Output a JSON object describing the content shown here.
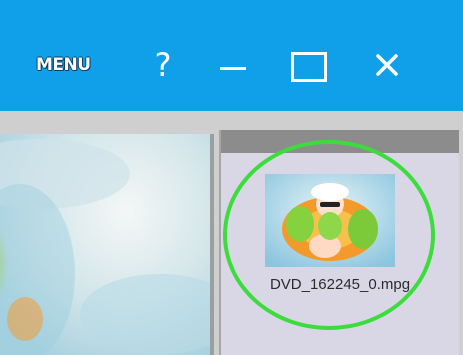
{
  "titlebar": {
    "background": "#10a0ea",
    "menu_label": "MENU",
    "help_label": "?",
    "icons": [
      "help-icon",
      "minimize-icon",
      "maximize-icon",
      "close-icon"
    ]
  },
  "media_list": {
    "items": [
      {
        "filename": "DVD_162245_0.mpg",
        "selected": true
      }
    ],
    "highlight_color": "#3ddc3d"
  }
}
